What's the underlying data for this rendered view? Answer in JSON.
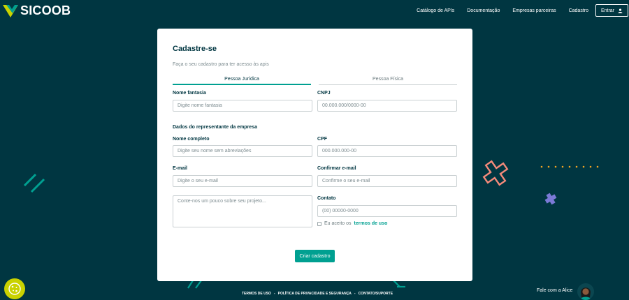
{
  "header": {
    "brand": "SICOOB",
    "nav": [
      "Catálogo de APIs",
      "Documentação",
      "Empresas parceiras",
      "Cadastro"
    ],
    "enter_label": "Entrar"
  },
  "form": {
    "title": "Cadastre-se",
    "subtitle": "Faça o seu cadastro para ter acesso às apis",
    "tabs": [
      "Pessoa Jurídica",
      "Pessoa Física"
    ],
    "nome_fantasia": {
      "label": "Nome fantasia",
      "placeholder": "Digite nome fantasia"
    },
    "cnpj": {
      "label": "CNPJ",
      "placeholder": "00.000.000/0000-00"
    },
    "section_title": "Dados do representante da empresa",
    "nome_completo": {
      "label": "Nome completo",
      "placeholder": "Digite seu nome sem abreviações"
    },
    "cpf": {
      "label": "CPF",
      "placeholder": "000.000.000-00"
    },
    "email": {
      "label": "E-mail",
      "placeholder": "Digite o seu e-mail"
    },
    "confirm_email": {
      "label": "Confirmar e-mail",
      "placeholder": "Confirme o seu e-mail"
    },
    "message": {
      "placeholder": "Conte-nos um pouco sobre seu projeto..."
    },
    "contato": {
      "label": "Contato",
      "placeholder": "(00) 00000-0000"
    },
    "terms_prefix": "Eu aceito os",
    "terms_link": "termos de uso",
    "submit_label": "Criar cadastro"
  },
  "footer": {
    "links": [
      "TERMOS DE USO",
      "POLÍTICA DE PRIVACIDADE E SEGURANÇA",
      "CONTATO/SUPORTE"
    ],
    "separator": "-"
  },
  "chat": {
    "label": "Fale com a Alice"
  },
  "colors": {
    "background": "#003641",
    "accent": "#00a091",
    "lime": "#c9d200",
    "coral": "#f48a7a",
    "purple": "#7b7ad6",
    "orange": "#f5a623"
  },
  "icons": [
    "sicoob-logo-icon",
    "user-icon",
    "cookie-icon",
    "alice-avatar-icon"
  ]
}
